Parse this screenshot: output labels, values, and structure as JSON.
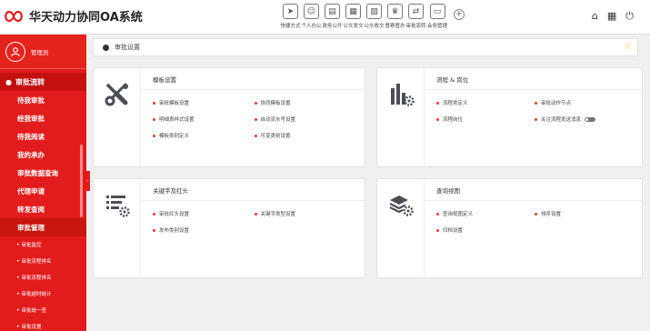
{
  "app": {
    "title": "华天动力协同OA系统"
  },
  "toolbar": [
    {
      "label": "快捷方式",
      "icon": "paper-plane-icon",
      "glyph": "➤"
    },
    {
      "label": "个人办公",
      "icon": "person-icon",
      "glyph": "☺"
    },
    {
      "label": "政务公开",
      "icon": "chat-icon",
      "glyph": "▤"
    },
    {
      "label": "公文发文",
      "icon": "doc-out-icon",
      "glyph": "▦"
    },
    {
      "label": "公文收文",
      "icon": "doc-in-icon",
      "glyph": "▧"
    },
    {
      "label": "督察督办",
      "icon": "badge-icon",
      "glyph": "♛"
    },
    {
      "label": "审批流转",
      "icon": "flow-icon",
      "glyph": "⇄"
    },
    {
      "label": "会务管理",
      "icon": "meeting-icon",
      "glyph": "▭"
    }
  ],
  "top_right": {
    "home": "⌂",
    "grid": "▦",
    "power": "⏻"
  },
  "sidebar": {
    "user": "管理员",
    "section": "审批流转",
    "items": [
      "待我审批",
      "经我审批",
      "待我阅读",
      "我的承办",
      "审批数据查询",
      "代理申请",
      "转发查阅",
      "审批管理"
    ],
    "active": "审批管理",
    "sub_items": [
      "审批监控",
      "审批流程排名",
      "审批流程排名",
      "审批超时统计",
      "审批统一查",
      "审批设置"
    ]
  },
  "breadcrumb": {
    "text": "审批设置"
  },
  "cards": [
    {
      "title": "模板设置",
      "icon": "tools-icon",
      "items": [
        "审批模板设置",
        "协同模板设置",
        "明细表样式设置",
        "自动流水号设置",
        "模板类别定义",
        "可变类别设置"
      ]
    },
    {
      "title": "流程 & 岗位",
      "icon": "bar-chart-gear-icon",
      "items": [
        "流程类定义",
        "审批动作节点",
        "流程岗位",
        "关注流程发送消息"
      ]
    },
    {
      "title": "关键字及红头",
      "icon": "list-gear-icon",
      "items": [
        "审批红头设置",
        "关键字类型设置",
        "发布类别设置"
      ]
    },
    {
      "title": "查询视图",
      "icon": "layers-gear-icon",
      "items": [
        "查询视图定义",
        "排序设置",
        "归档设置"
      ]
    }
  ],
  "colors": {
    "brand_red": "#e21c1c",
    "accent_star": "#f4b22a"
  }
}
